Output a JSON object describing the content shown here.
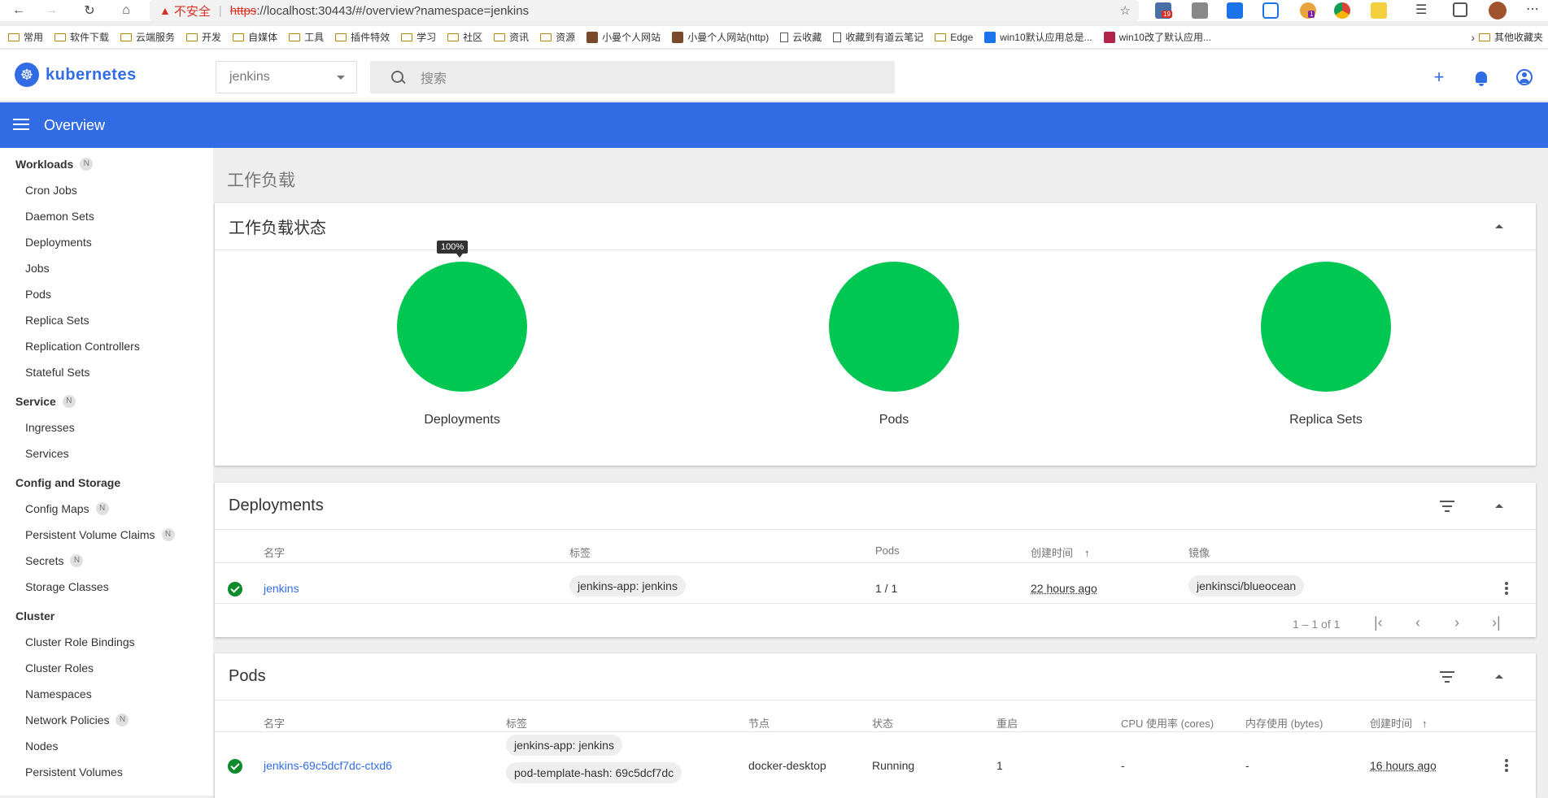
{
  "browser": {
    "insecure_label": "不安全",
    "url_protocol": "https",
    "url_rest": "://localhost:30443/#/overview?namespace=jenkins",
    "ext_badge_1": "19",
    "ext_badge_2": "1"
  },
  "bookmarks": [
    {
      "label": "常用",
      "icon": "folder-icon"
    },
    {
      "label": "软件下载",
      "icon": "folder-icon"
    },
    {
      "label": "云端服务",
      "icon": "folder-icon"
    },
    {
      "label": "开发",
      "icon": "folder-icon"
    },
    {
      "label": "自媒体",
      "icon": "folder-icon"
    },
    {
      "label": "工具",
      "icon": "folder-icon"
    },
    {
      "label": "插件特效",
      "icon": "folder-icon"
    },
    {
      "label": "学习",
      "icon": "folder-icon"
    },
    {
      "label": "社区",
      "icon": "folder-icon"
    },
    {
      "label": "资讯",
      "icon": "folder-icon"
    },
    {
      "label": "资源",
      "icon": "folder-icon"
    },
    {
      "label": "小曼个人网站",
      "icon": "site-icon"
    },
    {
      "label": "小曼个人网站(http)",
      "icon": "site-icon"
    },
    {
      "label": "云收藏",
      "icon": "page-icon"
    },
    {
      "label": "收藏到有道云笔记",
      "icon": "page-icon"
    },
    {
      "label": "Edge",
      "icon": "folder-icon"
    },
    {
      "label": "win10默认应用总是...",
      "icon": "zhihu-icon"
    },
    {
      "label": "win10改了默认应用...",
      "icon": "site-red-icon"
    }
  ],
  "bookmarks_other": "其他收藏夹",
  "header": {
    "logo_text": "kubernetes",
    "namespace": "jenkins",
    "search_placeholder": "搜索",
    "bar_title": "Overview"
  },
  "sidebar": {
    "sections": [
      {
        "title": "Workloads",
        "badge": "N",
        "items": [
          {
            "label": "Cron Jobs"
          },
          {
            "label": "Daemon Sets"
          },
          {
            "label": "Deployments"
          },
          {
            "label": "Jobs"
          },
          {
            "label": "Pods"
          },
          {
            "label": "Replica Sets"
          },
          {
            "label": "Replication Controllers"
          },
          {
            "label": "Stateful Sets"
          }
        ]
      },
      {
        "title": "Service",
        "badge": "N",
        "items": [
          {
            "label": "Ingresses"
          },
          {
            "label": "Services"
          }
        ]
      },
      {
        "title": "Config and Storage",
        "badge": "",
        "items": [
          {
            "label": "Config Maps",
            "badge": "N"
          },
          {
            "label": "Persistent Volume Claims",
            "badge": "N"
          },
          {
            "label": "Secrets",
            "badge": "N"
          },
          {
            "label": "Storage Classes"
          }
        ]
      },
      {
        "title": "Cluster",
        "badge": "",
        "items": [
          {
            "label": "Cluster Role Bindings"
          },
          {
            "label": "Cluster Roles"
          },
          {
            "label": "Namespaces"
          },
          {
            "label": "Network Policies",
            "badge": "N"
          },
          {
            "label": "Nodes"
          },
          {
            "label": "Persistent Volumes"
          }
        ]
      }
    ]
  },
  "main": {
    "page_title": "工作负载",
    "status_card": {
      "title": "工作负载状态",
      "tooltip": "100%",
      "charts": [
        {
          "label": "Deployments",
          "percent": 100
        },
        {
          "label": "Pods",
          "percent": 100
        },
        {
          "label": "Replica Sets",
          "percent": 100
        }
      ]
    },
    "deployments": {
      "title": "Deployments",
      "columns": {
        "name": "名字",
        "labels": "标签",
        "pods": "Pods",
        "created": "创建时间",
        "images": "镜像"
      },
      "rows": [
        {
          "name": "jenkins",
          "label": "jenkins-app: jenkins",
          "pods": "1 / 1",
          "created": "22 hours ago",
          "image": "jenkinsci/blueocean"
        }
      ],
      "pager": "1 – 1 of 1"
    },
    "pods": {
      "title": "Pods",
      "columns": {
        "name": "名字",
        "labels": "标签",
        "node": "节点",
        "status": "状态",
        "restarts": "重启",
        "cpu": "CPU 使用率 (cores)",
        "memory": "内存使用 (bytes)",
        "created": "创建时间"
      },
      "rows": [
        {
          "name": "jenkins-69c5dcf7dc-ctxd6",
          "label_1": "jenkins-app: jenkins",
          "label_2": "pod-template-hash: 69c5dcf7dc",
          "node": "docker-desktop",
          "status": "Running",
          "restarts": "1",
          "cpu": "-",
          "memory": "-",
          "created": "16 hours ago"
        }
      ]
    }
  },
  "colors": {
    "accent": "#326ce5",
    "healthy": "#00c752",
    "ok_icon": "#0d8a2c"
  }
}
